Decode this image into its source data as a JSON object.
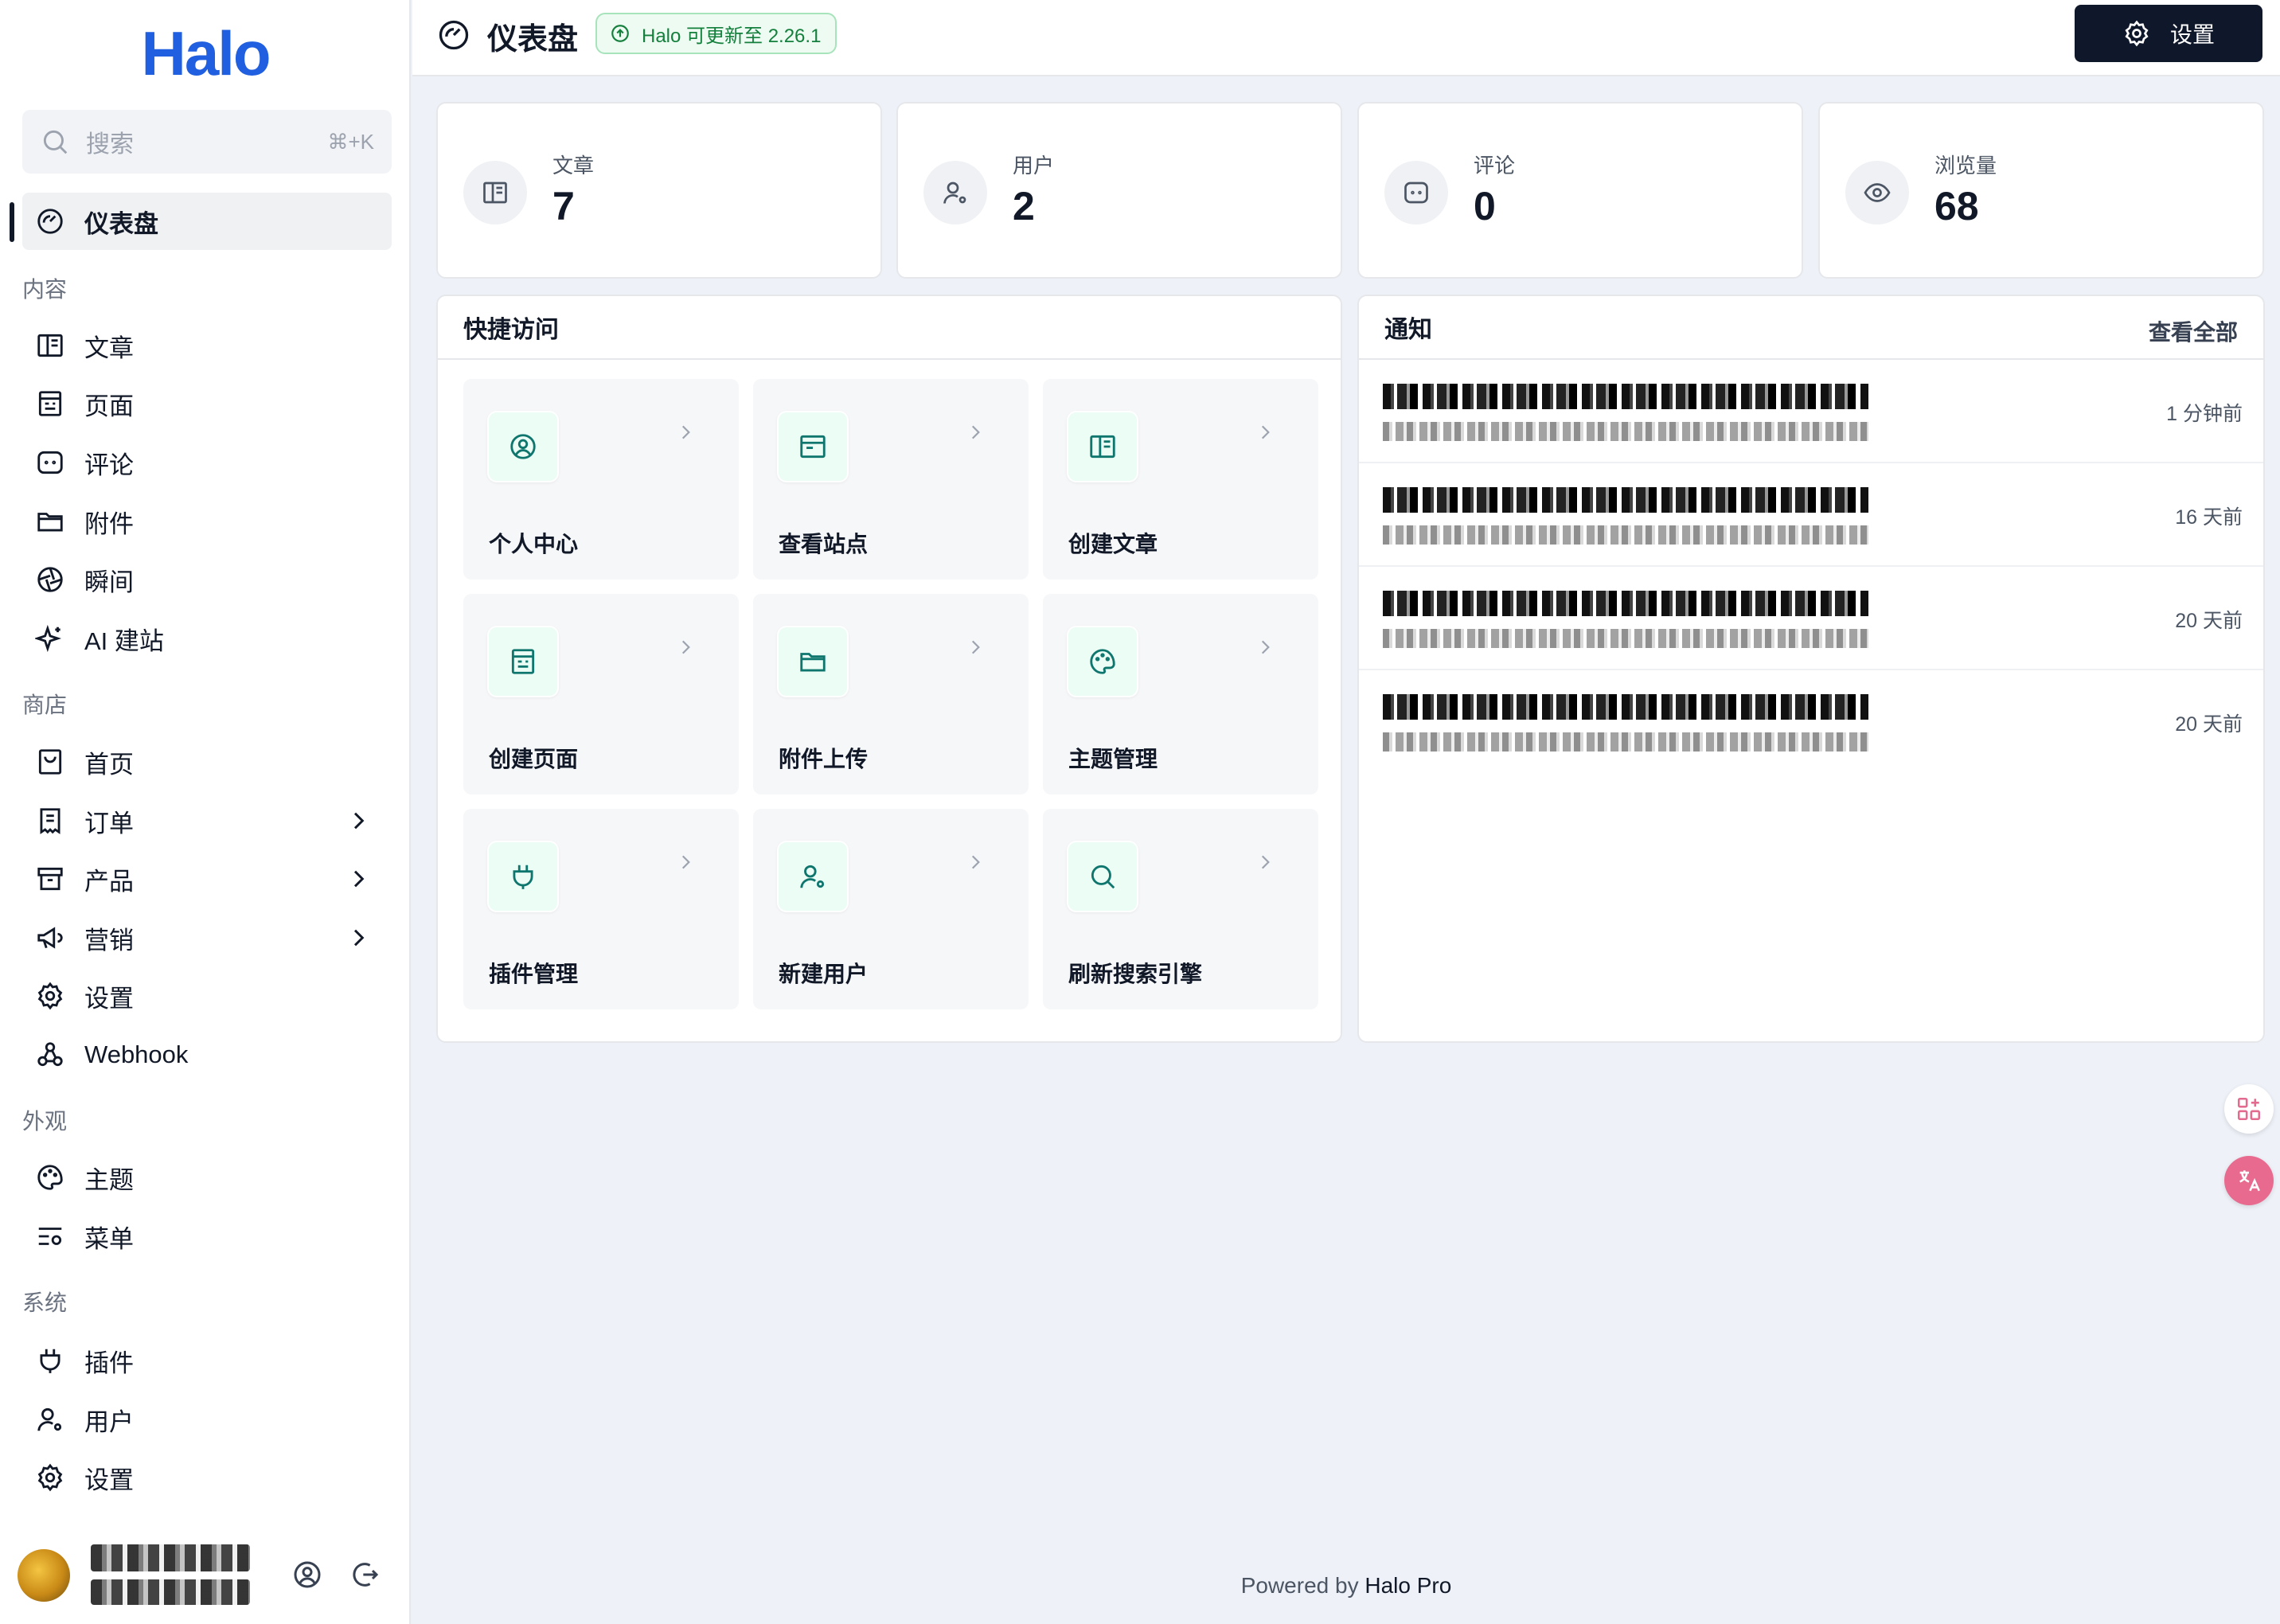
{
  "app": {
    "logo": "Halo"
  },
  "search": {
    "placeholder": "搜索",
    "shortcut": "⌘+K"
  },
  "sidebar": {
    "dashboard": "仪表盘",
    "groups": {
      "content": "内容",
      "shop": "商店",
      "appearance": "外观",
      "system": "系统"
    },
    "content_items": [
      {
        "label": "文章",
        "icon": "book-icon"
      },
      {
        "label": "页面",
        "icon": "page-icon"
      },
      {
        "label": "评论",
        "icon": "comment-icon"
      },
      {
        "label": "附件",
        "icon": "folder-icon"
      },
      {
        "label": "瞬间",
        "icon": "aperture-icon"
      },
      {
        "label": "AI 建站",
        "icon": "sparkle-icon"
      }
    ],
    "shop_items": [
      {
        "label": "首页",
        "icon": "shop-home-icon"
      },
      {
        "label": "订单",
        "icon": "order-icon"
      },
      {
        "label": "产品",
        "icon": "product-icon"
      },
      {
        "label": "营销",
        "icon": "megaphone-icon"
      },
      {
        "label": "设置",
        "icon": "gear-icon"
      },
      {
        "label": "Webhook",
        "icon": "webhook-icon"
      }
    ],
    "appearance_items": [
      {
        "label": "主题",
        "icon": "palette-icon"
      },
      {
        "label": "菜单",
        "icon": "menu-icon"
      }
    ],
    "system_items": [
      {
        "label": "插件",
        "icon": "plug-icon"
      },
      {
        "label": "用户",
        "icon": "user-icon"
      },
      {
        "label": "设置",
        "icon": "gear-icon"
      }
    ]
  },
  "header": {
    "title": "仪表盘",
    "update_badge": "Halo 可更新至 2.26.1",
    "settings_label": "设置"
  },
  "stats": [
    {
      "label": "文章",
      "value": "7",
      "icon": "book-icon"
    },
    {
      "label": "用户",
      "value": "2",
      "icon": "user-gear-icon"
    },
    {
      "label": "评论",
      "value": "0",
      "icon": "comment-icon"
    },
    {
      "label": "浏览量",
      "value": "68",
      "icon": "eye-icon"
    }
  ],
  "quick_access": {
    "title": "快捷访问",
    "items": [
      {
        "label": "个人中心",
        "icon": "user-circle-icon"
      },
      {
        "label": "查看站点",
        "icon": "browser-icon"
      },
      {
        "label": "创建文章",
        "icon": "book-icon"
      },
      {
        "label": "创建页面",
        "icon": "page-icon"
      },
      {
        "label": "附件上传",
        "icon": "folder-icon"
      },
      {
        "label": "主题管理",
        "icon": "palette-icon"
      },
      {
        "label": "插件管理",
        "icon": "plug-icon"
      },
      {
        "label": "新建用户",
        "icon": "user-gear-icon"
      },
      {
        "label": "刷新搜索引擎",
        "icon": "search-icon"
      }
    ]
  },
  "notifications": {
    "title": "通知",
    "view_all": "查看全部",
    "items": [
      {
        "time": "1 分钟前"
      },
      {
        "time": "16 天前"
      },
      {
        "time": "20 天前"
      },
      {
        "time": "20 天前"
      }
    ]
  },
  "footer": {
    "prefix": "Powered by ",
    "brand": "Halo Pro"
  },
  "colors": {
    "brand": "#1f5fe0",
    "accent_green": "#0f766e",
    "badge_green": "#15803d",
    "dark_button": "#0f172a",
    "background": "#eef2f8"
  }
}
